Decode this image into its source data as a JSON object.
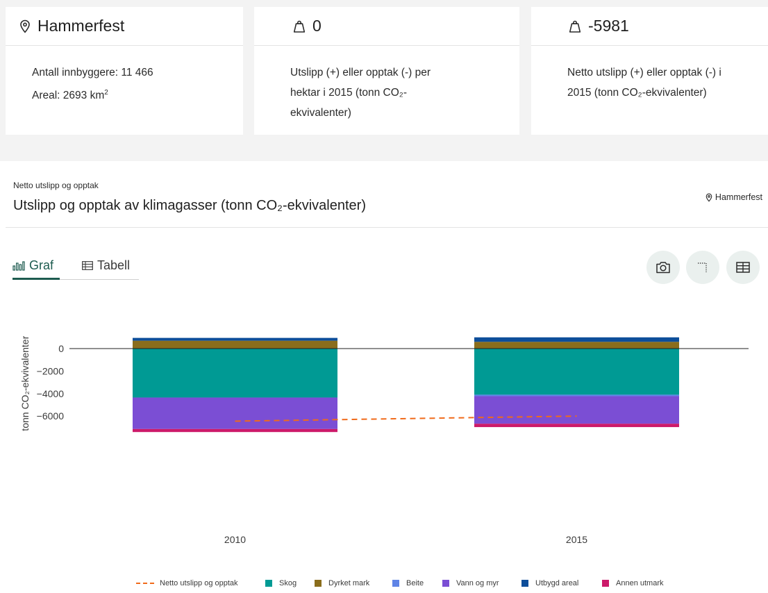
{
  "cards": [
    {
      "head": "Hammerfest",
      "desc_line1": "Antall innbyggere: 11 466",
      "desc_line2_prefix": "Areal: 2693 km",
      "desc_line2_sup": "2"
    },
    {
      "head": "0",
      "desc": [
        "Utslipp (+) eller opptak (-) per",
        "hektar i 2015 (tonn CO₂-",
        "ekvivalenter)"
      ]
    },
    {
      "head": "-5981",
      "desc": [
        "Netto utslipp (+) eller opptak (-) i",
        "2015 (tonn CO₂-ekvivalenter)"
      ]
    }
  ],
  "section": {
    "kicker": "Netto utslipp og opptak",
    "title": "Utslipp og opptak av klimagasser (tonn CO₂-ekvivalenter)",
    "place": "Hammerfest"
  },
  "tabs": {
    "graf": "Graf",
    "tabell": "Tabell"
  },
  "toolbar_icons": [
    "camera-icon",
    "filter-icon",
    "table-icon"
  ],
  "chart_data": {
    "type": "bar",
    "stacked": true,
    "categories": [
      "2010",
      "2015"
    ],
    "ylabel": "tonn CO₂-ekvivalenter",
    "ylim": [
      -7500,
      1100
    ],
    "yticks": [
      0,
      -2000,
      -4000,
      -6000
    ],
    "ytick_labels": [
      "0",
      "−2000",
      "−4000",
      "−6000"
    ],
    "series": [
      {
        "name": "Skog",
        "color": "#009a94",
        "values": [
          -4350,
          -4100
        ]
      },
      {
        "name": "Dyrket mark",
        "color": "#8a6d1c",
        "values": [
          700,
          600
        ]
      },
      {
        "name": "Beite",
        "color": "#5f84e6",
        "values": [
          0,
          -130
        ]
      },
      {
        "name": "Vann og myr",
        "color": "#7b4ed4",
        "values": [
          -2800,
          -2450
        ]
      },
      {
        "name": "Utbygd areal",
        "color": "#0d4e9a",
        "values": [
          250,
          400
        ]
      },
      {
        "name": "Annen utmark",
        "color": "#cc1a6a",
        "values": [
          -270,
          -300
        ]
      }
    ],
    "line": {
      "name": "Netto utslipp og opptak",
      "color": "#f06a1a",
      "values": [
        -6450,
        -6000
      ]
    },
    "legend_position": "bottom"
  }
}
